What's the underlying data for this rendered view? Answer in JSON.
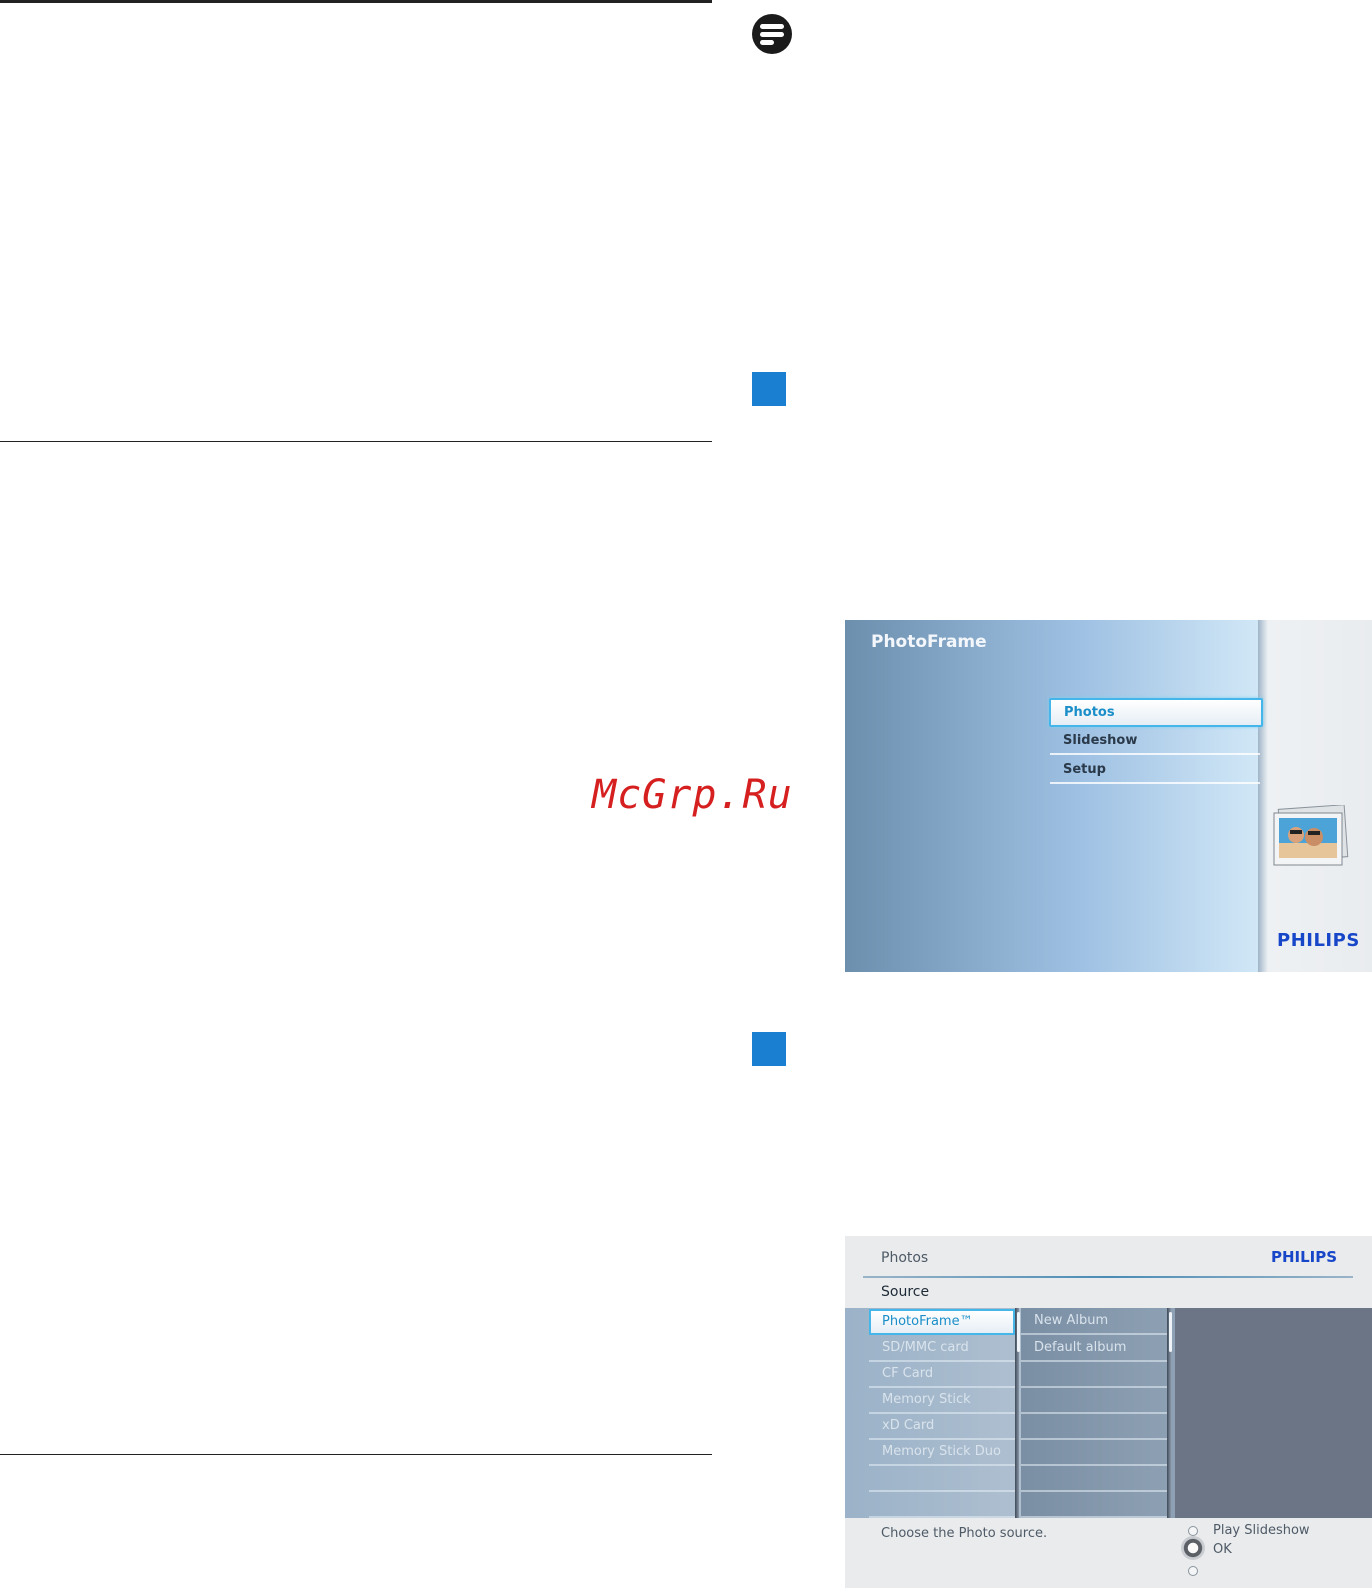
{
  "watermark": "McGrp.Ru",
  "photoframe_menu": {
    "title": "PhotoFrame",
    "items": [
      "Photos",
      "Slideshow",
      "Setup"
    ],
    "selected": "Photos",
    "brand": "PHILIPS"
  },
  "photos_source_menu": {
    "header": "Photos",
    "brand": "PHILIPS",
    "section": "Source",
    "sources": [
      "PhotoFrame™",
      "SD/MMC card",
      "CF Card",
      "Memory Stick",
      "xD Card",
      "Memory Stick Duo"
    ],
    "selected_source": "PhotoFrame™",
    "albums": [
      "New Album",
      "Default album"
    ],
    "hint": "Choose the Photo source.",
    "controls": {
      "play_label": "Play Slideshow",
      "ok_label": "OK"
    }
  },
  "colors": {
    "step_marker": "#1b7fd1",
    "brand_blue": "#1746c9",
    "selection_border": "#44b6ea",
    "watermark": "#d62020"
  },
  "icons": {
    "note": "note-icon",
    "step": "step-square-icon"
  }
}
